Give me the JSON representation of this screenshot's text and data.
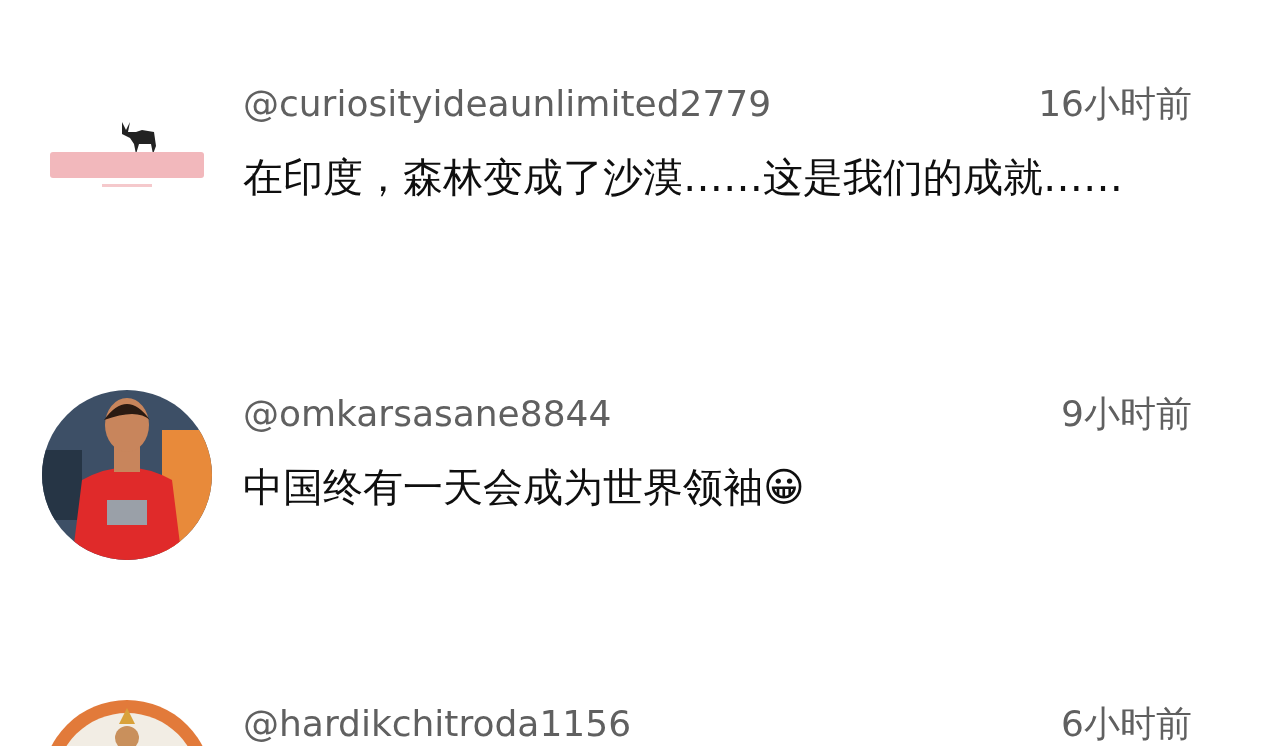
{
  "comments": [
    {
      "author": "@curiosityideaunlimited2779",
      "time": "16小时前",
      "text": "在印度，森林变成了沙漠……这是我们的成就……",
      "avatar": {
        "kind": "logo"
      }
    },
    {
      "author": "@omkarsasane8844",
      "time": "9小时前",
      "text": "中国终有一天会成为世界领袖😀"
    },
    {
      "author": "@hardikchitroda1156",
      "time": "6小时前",
      "avatar": {
        "kind": "emblem"
      }
    }
  ]
}
